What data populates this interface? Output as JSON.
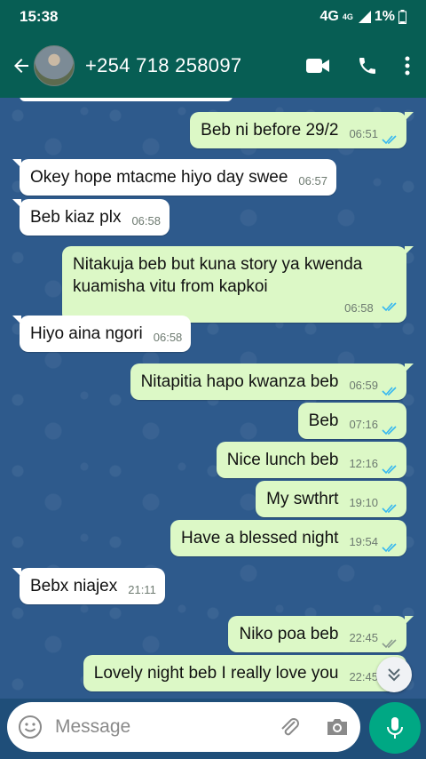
{
  "status": {
    "time": "15:38",
    "network": "4G",
    "network_sup": "4G",
    "battery": "1%"
  },
  "header": {
    "contact": "+254 718 258097"
  },
  "messages": [
    {
      "dir": "out",
      "text": "Beb ni before 29/2",
      "time": "06:51",
      "read": true
    },
    {
      "dir": "in",
      "text": "Okey hope mtacme hiyo day swee",
      "time": "06:57"
    },
    {
      "dir": "in",
      "text": "Beb kiaz plx",
      "time": "06:58"
    },
    {
      "dir": "out",
      "text": "Nitakuja beb but kuna story ya kwenda kuamisha vitu from kapkoi",
      "time": "06:58",
      "read": true
    },
    {
      "dir": "in",
      "text": "Hiyo aina ngori",
      "time": "06:58"
    },
    {
      "dir": "out",
      "text": "Nitapitia hapo kwanza beb",
      "time": "06:59",
      "read": true
    },
    {
      "dir": "out",
      "text": "Beb",
      "time": "07:16",
      "read": true
    },
    {
      "dir": "out",
      "text": "Nice lunch beb",
      "time": "12:16",
      "read": true
    },
    {
      "dir": "out",
      "text": "My swthrt",
      "time": "19:10",
      "read": true
    },
    {
      "dir": "out",
      "text": "Have a blessed night",
      "time": "19:54",
      "read": true
    },
    {
      "dir": "in",
      "text": "Bebx niajex",
      "time": "21:11"
    },
    {
      "dir": "out",
      "text": "Niko poa beb",
      "time": "22:45",
      "read": false
    },
    {
      "dir": "out",
      "text": "Lovely night beb I really love you",
      "time": "22:45",
      "read": false
    }
  ],
  "composer": {
    "placeholder": "Message"
  },
  "colors": {
    "header": "#075e54",
    "outgoing": "#dcf8c6",
    "incoming": "#ffffff",
    "read_tick": "#34b7f1",
    "mic": "#00a884"
  }
}
